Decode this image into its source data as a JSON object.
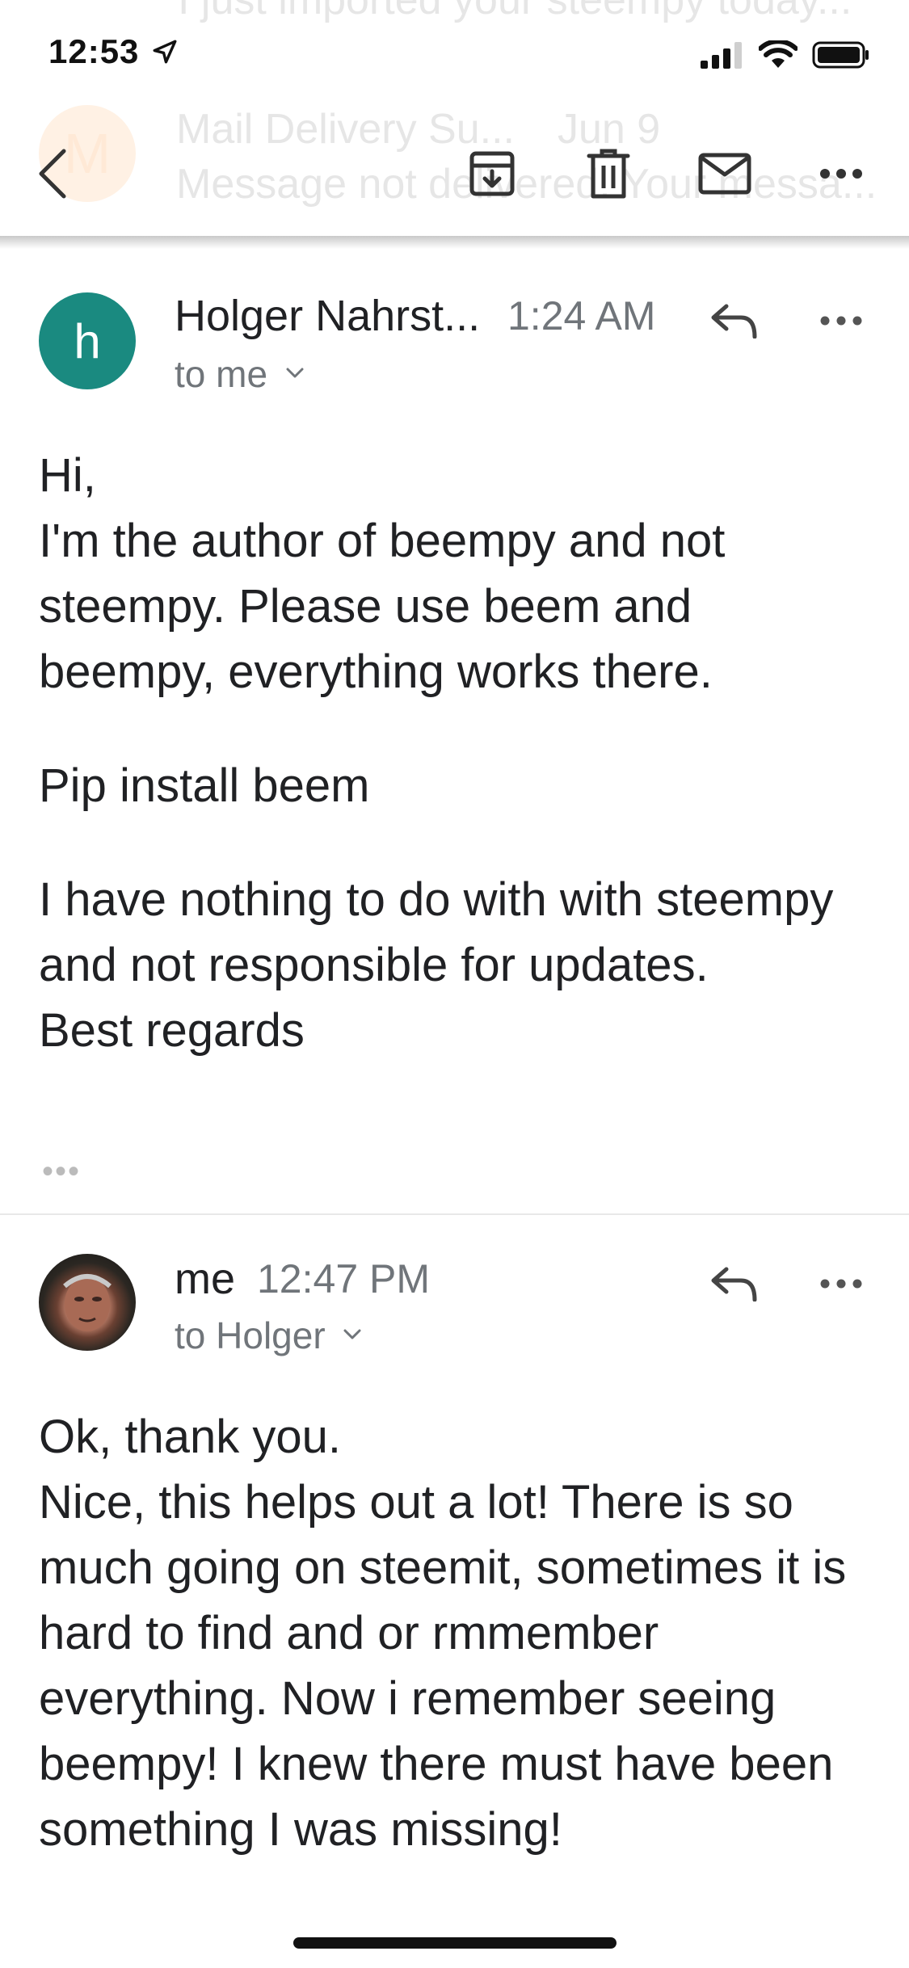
{
  "status_bar": {
    "time": "12:53"
  },
  "background_list": {
    "top_item_preview": "I just imported your steempy today...",
    "item_avatar_letter": "M",
    "item_sender": "Mail Delivery Su...",
    "item_date": "Jun 9",
    "item_preview": "Message not delivered. Your messa..."
  },
  "toolbar": {
    "back_icon": "chevron-left-icon",
    "archive_icon": "archive-icon",
    "delete_icon": "trash-icon",
    "mark_unread_icon": "mail-icon",
    "more_icon": "more-horizontal-icon"
  },
  "messages": [
    {
      "avatar_letter": "h",
      "avatar_color": "#1a8a80",
      "sender": "Holger Nahrst...",
      "time": "1:24 AM",
      "recipient": "to me",
      "body": [
        [
          "Hi,",
          "I'm the author of beempy and not steempy. Please use beem and beempy, everything works there."
        ],
        [
          "Pip install beem"
        ],
        [
          "I have nothing to do with with steempy and not responsible for updates.",
          "Best regards"
        ]
      ],
      "trimmed_indicator": "•••"
    },
    {
      "sender": "me",
      "time": "12:47 PM",
      "recipient": "to Holger",
      "body": [
        [
          "Ok, thank you.",
          "Nice, this helps out a lot! There is so much going on steemit, sometimes it is hard to find and or rmmember everything. Now i remember seeing beempy! I knew there must have been something I was missing!"
        ]
      ]
    }
  ],
  "colors": {
    "accent_avatar": "#1a8a80",
    "text_primary": "#202124",
    "text_secondary": "#70757a"
  }
}
